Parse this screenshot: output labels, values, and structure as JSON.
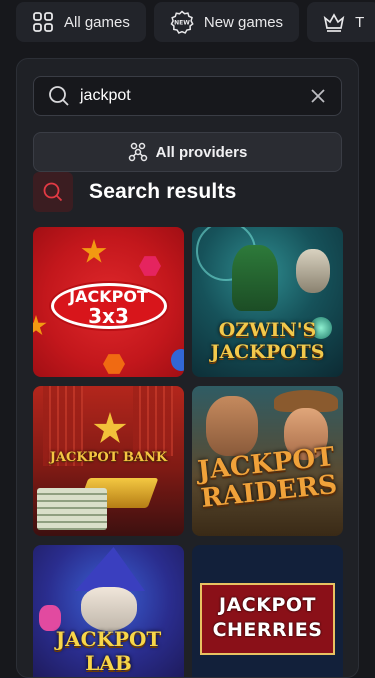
{
  "topnav": {
    "items": [
      {
        "label": "All games",
        "icon": "grid-icon"
      },
      {
        "label": "New games",
        "icon": "new-badge-icon"
      },
      {
        "label": "T",
        "icon": "crown-icon"
      }
    ]
  },
  "search": {
    "value": "jackpot",
    "icon": "search-icon",
    "clear_icon": "close-icon"
  },
  "providers": {
    "label": "All providers",
    "icon": "providers-icon"
  },
  "results": {
    "title": "Search results",
    "icon": "search-icon"
  },
  "games": [
    {
      "name": "Jackpot 3x3",
      "line1": "JACKPOT",
      "line2": "3x3"
    },
    {
      "name": "Ozwin's Jackpots",
      "line1": "OZWIN'S",
      "line2": "JACKPOTS"
    },
    {
      "name": "Jackpot Bank",
      "line1": "JACKPOT BANK"
    },
    {
      "name": "Jackpot Raiders",
      "line1": "JACKPOT",
      "line2": "RAIDERS"
    },
    {
      "name": "Jackpot Lab",
      "line1": "JACKPOT",
      "line2": "LAB"
    },
    {
      "name": "Jackpot Cherries",
      "line1": "JACKPOT",
      "line2": "CHERRIES"
    }
  ],
  "colors": {
    "background": "#17181c",
    "panel": "#1f2126",
    "accent": "#e23a44"
  }
}
